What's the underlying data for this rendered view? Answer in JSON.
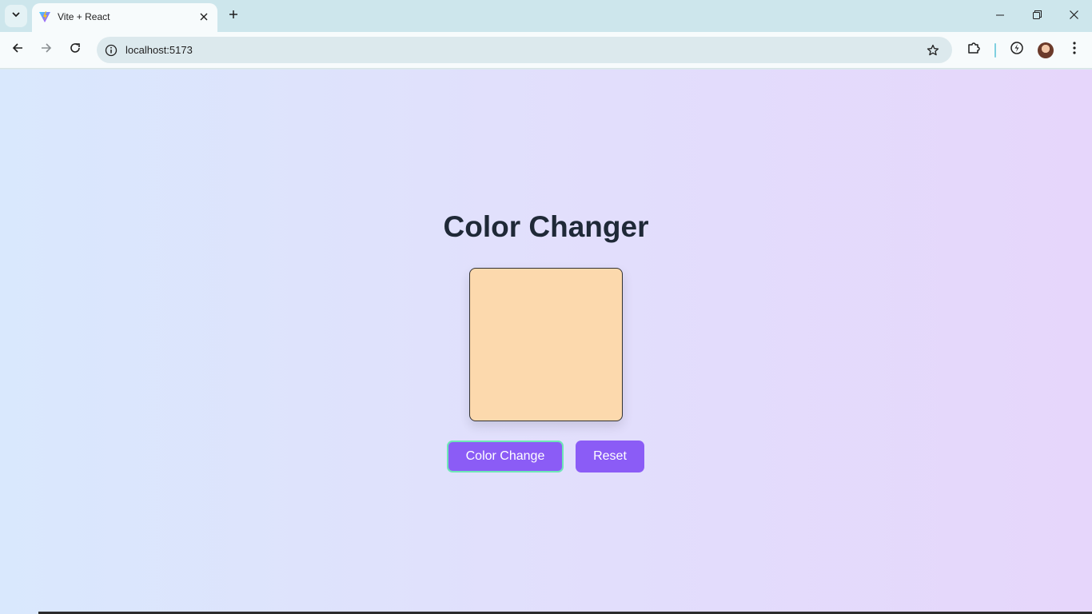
{
  "browser": {
    "tab_title": "Vite + React",
    "url": "localhost:5173",
    "icons": {
      "tab_search": "chevron-down-icon",
      "favicon": "vite-logo-icon",
      "tab_close": "close-icon",
      "new_tab": "plus-icon",
      "minimize": "minimize-icon",
      "restore": "restore-icon",
      "close_window": "close-icon",
      "back": "arrow-left-icon",
      "forward": "arrow-right-icon",
      "reload": "reload-icon",
      "site_info": "info-icon",
      "bookmark": "star-icon",
      "extensions": "puzzle-icon",
      "performance": "lightning-icon",
      "profile": "avatar",
      "menu": "more-vertical-icon"
    }
  },
  "page": {
    "heading": "Color Changer",
    "swatch_color": "#fcd9ad",
    "buttons": {
      "change_label": "Color Change",
      "reset_label": "Reset"
    },
    "colors": {
      "button_bg": "#8b5cf6",
      "button_focus_ring": "#6ee7b7",
      "heading": "#1f2937",
      "gradient_start": "#d9e8fd",
      "gradient_end": "#e6d6fb"
    }
  }
}
